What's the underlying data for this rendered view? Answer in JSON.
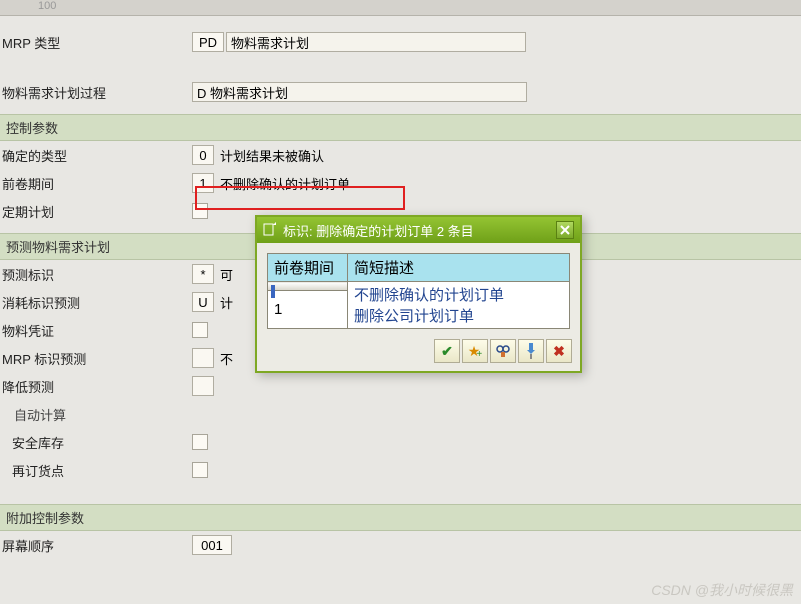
{
  "top_code": "100",
  "fields": {
    "mrp_type": {
      "label": "MRP 类型",
      "value": "PD",
      "desc": "物料需求计划"
    },
    "mrp_process": {
      "label": "物料需求计划过程",
      "value": "D 物料需求计划"
    }
  },
  "section1": {
    "title": "控制参数",
    "fixed_type": {
      "label": "确定的类型",
      "value": "0",
      "desc": "计划结果未被确认"
    },
    "roll_period": {
      "label": "前卷期间",
      "value": "1",
      "desc": "不删除确认的计划订单"
    },
    "fixed_plan": {
      "label": "定期计划"
    }
  },
  "section2": {
    "title": "预测物料需求计划",
    "forecast_flag": {
      "label": "预测标识",
      "value": "*",
      "desc": "可"
    },
    "consume_forecast": {
      "label": "消耗标识预测",
      "value": "U",
      "desc": "计"
    },
    "mat_doc": {
      "label": "物料凭证"
    },
    "mrp_flag_forecast": {
      "label": "MRP 标识预测",
      "desc": "不"
    },
    "reduce_forecast": {
      "label": "降低预测"
    },
    "auto_calc": "自动计算",
    "safety_stock": {
      "label": "安全库存"
    },
    "reorder_point": {
      "label": "再订货点"
    }
  },
  "section3": {
    "title": "附加控制参数",
    "screen_seq": {
      "label": "屏幕顺序",
      "value": "001"
    }
  },
  "popup": {
    "title": "标识: 删除确定的计划订单 2 条目",
    "headers": [
      "前卷期间",
      "简短描述"
    ],
    "rows": [
      {
        "code": "",
        "desc": "不删除确认的计划订单"
      },
      {
        "code": "1",
        "desc": "删除公司计划订单"
      }
    ],
    "buttons": {
      "ok": "✔",
      "fav": "★",
      "find": "binoculars",
      "pin": "pin",
      "cancel": "✖"
    }
  },
  "watermark": "CSDN @我小时候很黑"
}
